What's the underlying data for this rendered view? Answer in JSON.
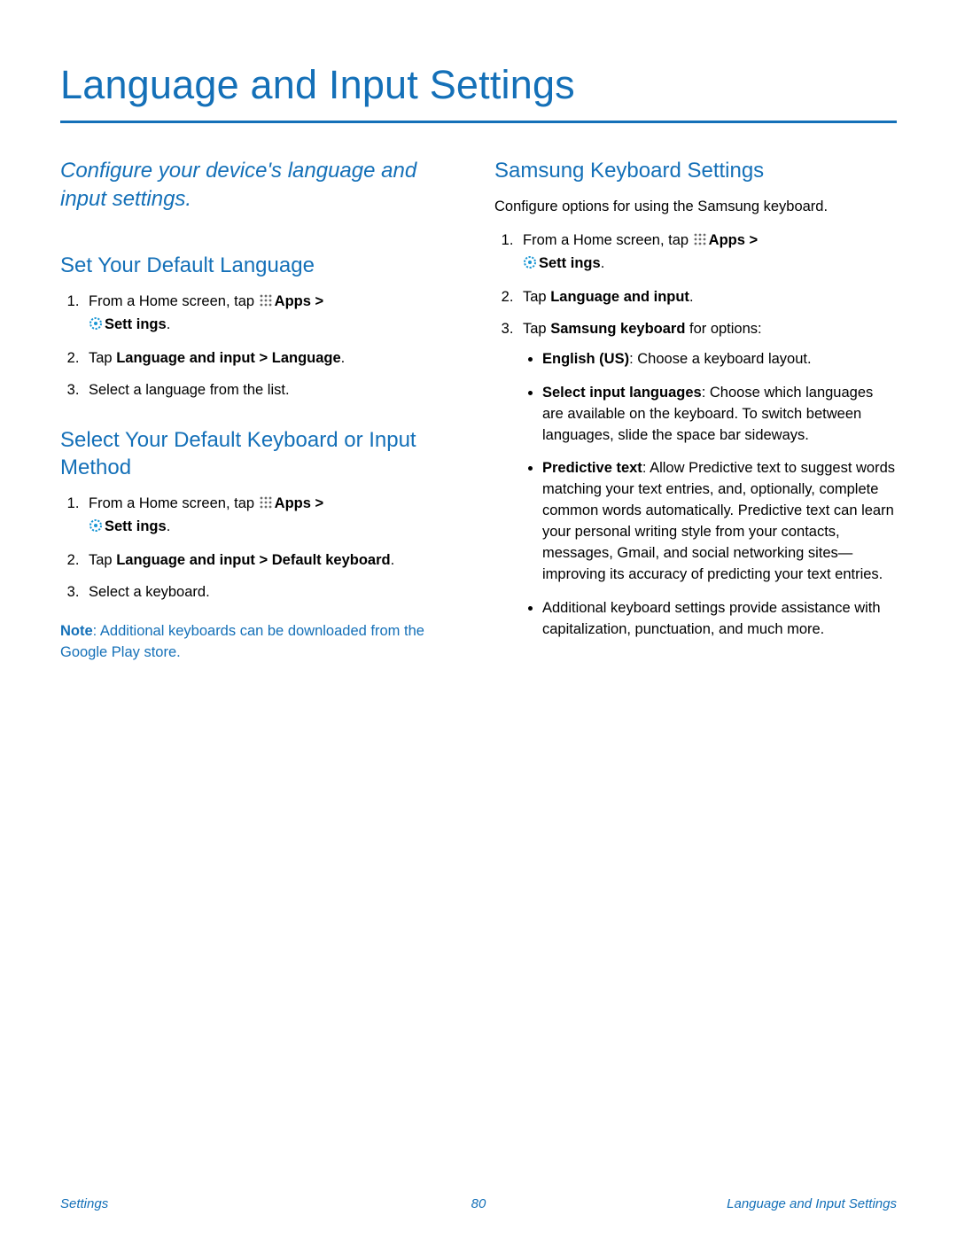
{
  "colors": {
    "accent": "#1470b8"
  },
  "page_title": "Language and Input Settings",
  "intro": "Configure your device's language and input settings.",
  "left": {
    "section1": {
      "heading": "Set Your Default Language",
      "step1_pre": "From a Home screen, tap ",
      "step1_apps": "Apps > ",
      "step1_settings": "Sett ings",
      "step1_post": ".",
      "step2_pre": "Tap ",
      "step2_bold": "Language and input > Language",
      "step2_post": ".",
      "step3": "Select a language from the list."
    },
    "section2": {
      "heading": "Select Your Default Keyboard or Input Method",
      "step1_pre": "From a Home screen, tap ",
      "step1_apps": "Apps > ",
      "step1_settings": "Sett ings",
      "step1_post": ".",
      "step2_pre": "Tap ",
      "step2_bold": "Language and input > Default keyboard",
      "step2_post": ".",
      "step3": "Select a keyboard.",
      "note_label": "Note",
      "note_text": ": Additional keyboards can be downloaded from the Google Play store."
    }
  },
  "right": {
    "heading": "Samsung Keyboard Settings",
    "intro_text": "Configure options for using the Samsung keyboard.",
    "step1_pre": "From a Home screen, tap ",
    "step1_apps": "Apps > ",
    "step1_settings": "Sett ings",
    "step1_post": ".",
    "step2_pre": "Tap ",
    "step2_bold": "Language and input",
    "step2_post": ".",
    "step3_pre": "Tap ",
    "step3_bold": "Samsung keyboard",
    "step3_post": " for options:",
    "b1_bold": "English (US)",
    "b1_text": ": Choose a keyboard layout.",
    "b2_bold": "Select input languages",
    "b2_text": ": Choose which languages are available on the keyboard. To switch between languages, slide the space bar sideways.",
    "b3_bold": "Predictive text",
    "b3_text": ": Allow Predictive text to suggest words matching your text entries, and, optionally, complete common words automatically. Predictive text can learn your personal writing style from your contacts, messages, Gmail, and social networking sites—improving its accuracy of predicting your text entries.",
    "b4_text": "Additional keyboard settings provide assistance with capitalization, punctuation, and much more."
  },
  "footer": {
    "left": "Settings",
    "center": "80",
    "right": "Language and Input Settings"
  },
  "icons": {
    "apps": "apps-grid-icon",
    "settings": "settings-gear-icon"
  }
}
